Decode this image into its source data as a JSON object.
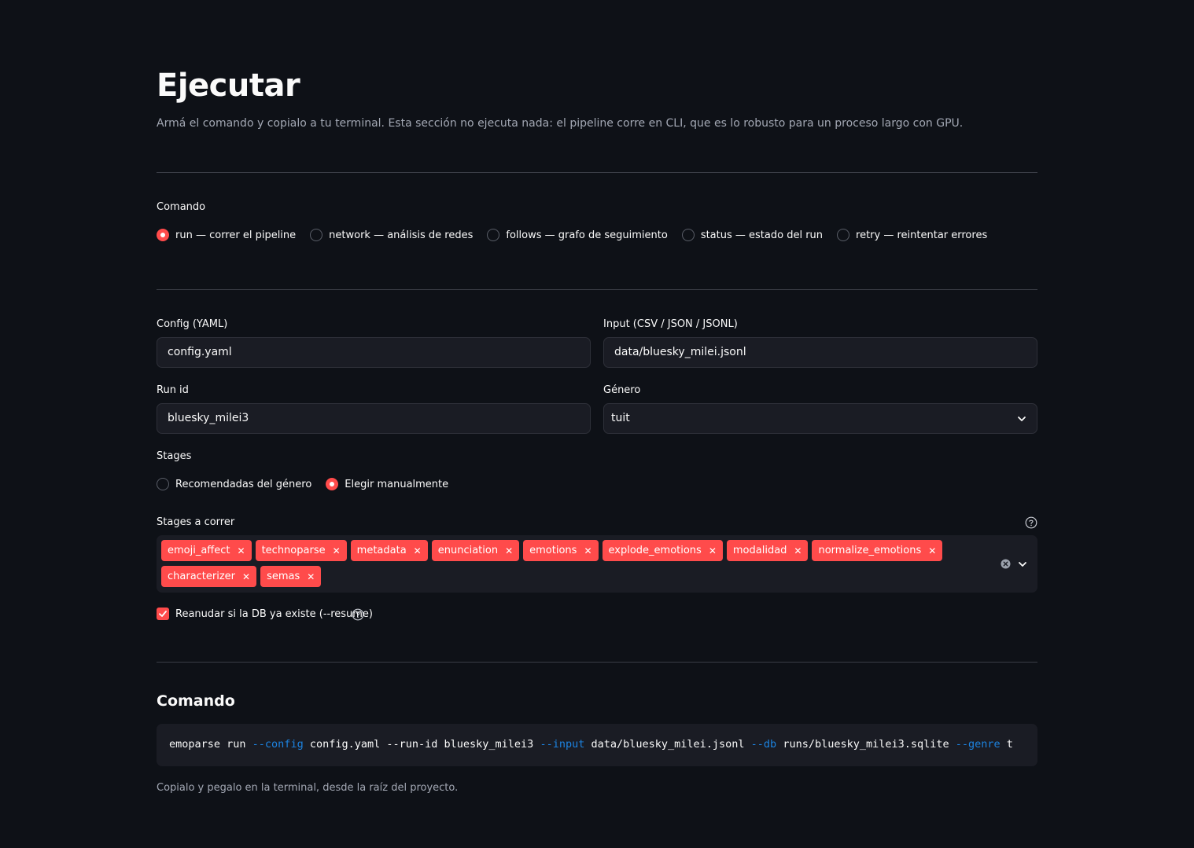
{
  "page": {
    "title": "Ejecutar",
    "subtitle": "Armá el comando y copialo a tu terminal. Esta sección no ejecuta nada: el pipeline corre en CLI, que es lo robusto para un proceso largo con GPU."
  },
  "command_selector": {
    "label": "Comando",
    "options": [
      {
        "label": "run — correr el pipeline",
        "selected": true
      },
      {
        "label": "network — análisis de redes",
        "selected": false
      },
      {
        "label": "follows — grafo de seguimiento",
        "selected": false
      },
      {
        "label": "status — estado del run",
        "selected": false
      },
      {
        "label": "retry — reintentar errores",
        "selected": false
      }
    ]
  },
  "form": {
    "config": {
      "label": "Config (YAML)",
      "value": "config.yaml"
    },
    "input": {
      "label": "Input (CSV / JSON / JSONL)",
      "value": "data/bluesky_milei.jsonl"
    },
    "run_id": {
      "label": "Run id",
      "value": "bluesky_milei3"
    },
    "genre": {
      "label": "Género",
      "value": "tuit"
    },
    "stages_mode": {
      "label": "Stages",
      "options": [
        {
          "label": "Recomendadas del género",
          "selected": false
        },
        {
          "label": "Elegir manualmente",
          "selected": true
        }
      ]
    },
    "stages": {
      "label": "Stages a correr",
      "selected": [
        "emoji_affect",
        "technoparse",
        "metadata",
        "enunciation",
        "emotions",
        "explode_emotions",
        "modalidad",
        "normalize_emotions",
        "characterizer",
        "semas"
      ]
    },
    "resume": {
      "label": "Reanudar si la DB ya existe (--resume)",
      "checked": true
    }
  },
  "output": {
    "title": "Comando",
    "command_parts": [
      {
        "text": "emoparse run ",
        "flag": false
      },
      {
        "text": "--config",
        "flag": true
      },
      {
        "text": " config.yaml --run-id bluesky_milei3 ",
        "flag": false
      },
      {
        "text": "--input",
        "flag": true
      },
      {
        "text": " data/bluesky_milei.jsonl ",
        "flag": false
      },
      {
        "text": "--db",
        "flag": true
      },
      {
        "text": " runs/bluesky_milei3.sqlite ",
        "flag": false
      },
      {
        "text": "--genre",
        "flag": true
      },
      {
        "text": " t",
        "flag": false
      }
    ],
    "caption": "Copialo y pegalo en la terminal, desde la raíz del proyecto."
  },
  "colors": {
    "background": "#0e1117",
    "accent": "#ff4b4b",
    "flag": "#1c83e1",
    "input_bg": "#1a1c24"
  },
  "icons": [
    "chevron-down-icon",
    "clear-icon",
    "help-icon",
    "check-icon",
    "close-icon"
  ]
}
